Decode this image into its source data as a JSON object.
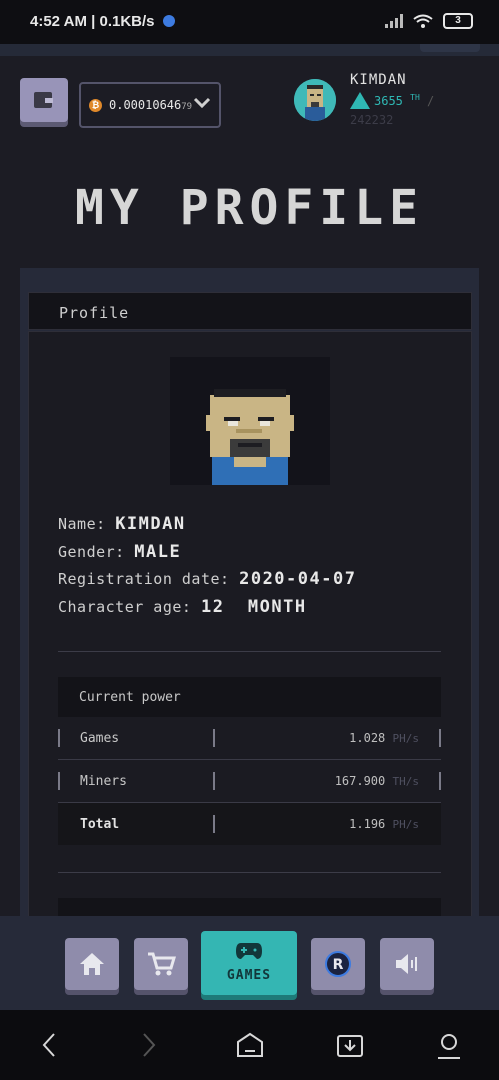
{
  "status_bar": {
    "time": "4:52 AM | 0.1KB/s",
    "battery": "3"
  },
  "header": {
    "balance_main": "0.00010646",
    "balance_tail": "79",
    "username": "KIMDAN",
    "power_value": "3655",
    "power_unit": "TH",
    "power_sep": "/",
    "power_total": "242232"
  },
  "page": {
    "title": "MY PROFILE"
  },
  "profile": {
    "card_title": "Profile",
    "name_label": "Name:",
    "name_value": "KIMDAN",
    "gender_label": "Gender:",
    "gender_value": "MALE",
    "registration_label": "Registration date:",
    "registration_value": "2020-04-07",
    "age_label": "Character age:",
    "age_value": "12  MONTH"
  },
  "current_power": {
    "title": "Current power",
    "rows": [
      {
        "label": "Games",
        "value": "1.028",
        "unit": "PH/s"
      },
      {
        "label": "Miners",
        "value": "167.900",
        "unit": "TH/s"
      },
      {
        "label": "Total",
        "value": "1.196",
        "unit": "PH/s"
      }
    ]
  },
  "bottom_nav": {
    "games_label": "GAMES"
  },
  "colors": {
    "accent": "#34b6b3",
    "button": "#8f8cab",
    "background": "#1c1c24"
  }
}
